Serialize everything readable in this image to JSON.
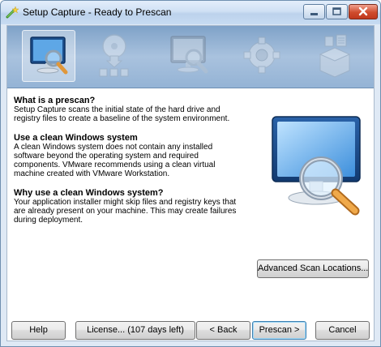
{
  "window": {
    "title": "Setup Capture - Ready to Prescan",
    "title_icon": "wand-icon"
  },
  "steps": [
    {
      "name": "prescan",
      "icon": "monitor-magnifier-icon",
      "active": true
    },
    {
      "name": "install",
      "icon": "disc-install-icon",
      "active": false
    },
    {
      "name": "postscan",
      "icon": "monitor-magnifier-icon",
      "active": false
    },
    {
      "name": "configure",
      "icon": "gear-icon",
      "active": false
    },
    {
      "name": "build",
      "icon": "package-icon",
      "active": false
    }
  ],
  "sections": [
    {
      "heading": "What is a prescan?",
      "lines": [
        "Setup Capture scans the initial state of the hard drive and",
        "registry files to create a baseline of the system environment."
      ]
    },
    {
      "heading": "Use a clean Windows system",
      "lines": [
        "A clean Windows system does not contain any installed",
        "software beyond the operating system and required",
        "components. VMware recommends using a clean virtual",
        "machine created with VMware Workstation."
      ]
    },
    {
      "heading": "Why use a clean Windows system?",
      "lines": [
        "Your application installer might skip files and registry keys that",
        "are already present on your machine. This may create failures",
        "during deployment."
      ]
    }
  ],
  "buttons": {
    "advanced": "Advanced Scan Locations...",
    "help": "Help",
    "license": "License... (107 days left)",
    "back": "< Back",
    "prescan": "Prescan >",
    "cancel": "Cancel"
  },
  "colors": {
    "stepbar": "#94b3d5",
    "close_button": "#cf4b2c",
    "default_button_border": "#3c7fb1"
  }
}
